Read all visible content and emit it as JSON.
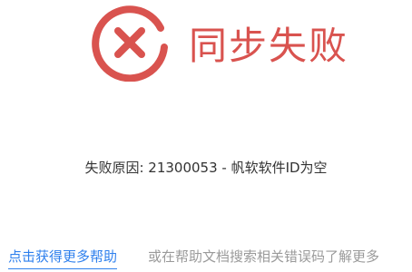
{
  "status": {
    "title": "同步失败",
    "icon": "error-x-circle-icon",
    "color": "#d9534f"
  },
  "reason": {
    "text": "失败原因: 21300053 - 帆软软件ID为空"
  },
  "help": {
    "link_label": "点击获得更多帮助",
    "link_color": "#2f80ed",
    "hint_text": "或在帮助文档搜索相关错误码了解更多"
  }
}
